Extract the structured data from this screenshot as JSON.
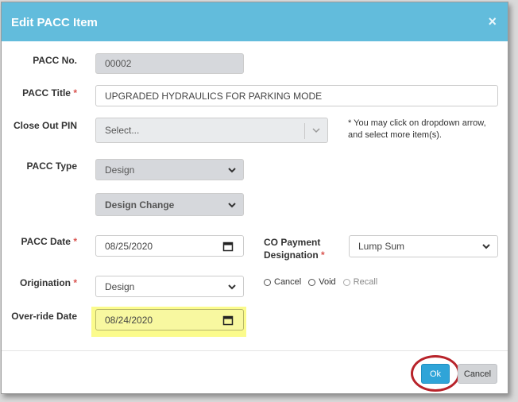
{
  "modal": {
    "title": "Edit PACC Item",
    "close_glyph": "×"
  },
  "colors": {
    "header": "#62bcdc",
    "required": "#d9534f",
    "ok_button": "#2fa4d8",
    "highlight": "#fbfb8c",
    "annotation_ring": "#b8232a"
  },
  "form": {
    "pacc_no": {
      "label": "PACC No.",
      "value": "00002"
    },
    "pacc_title": {
      "label": "PACC Title",
      "required_mark": "*",
      "value": "UPGRADED HYDRAULICS FOR PARKING MODE"
    },
    "close_out_pin": {
      "label": "Close Out PIN",
      "placeholder": "Select...",
      "note_line1": "* You may click on dropdown arrow,",
      "note_line2": "and select more item(s)."
    },
    "pacc_type": {
      "label": "PACC Type",
      "value": "Design",
      "subtype_value": "Design Change"
    },
    "pacc_date": {
      "label": "PACC Date",
      "required_mark": "*",
      "value": "08/25/2020"
    },
    "co_payment": {
      "label_line1": "CO Payment",
      "label_line2": "Designation",
      "required_mark": "*",
      "value": "Lump Sum"
    },
    "origination": {
      "label": "Origination",
      "required_mark": "*",
      "value": "Design"
    },
    "status_options": [
      {
        "label": "Cancel",
        "disabled": false
      },
      {
        "label": "Void",
        "disabled": false
      },
      {
        "label": "Recall",
        "disabled": true
      }
    ],
    "override_date": {
      "label": "Over-ride Date",
      "value": "08/24/2020"
    }
  },
  "footer": {
    "ok_label": "Ok",
    "cancel_label": "Cancel"
  },
  "icons": {
    "dropdown": "chevron-down-icon",
    "calendar": "calendar-icon",
    "close": "close-icon"
  }
}
